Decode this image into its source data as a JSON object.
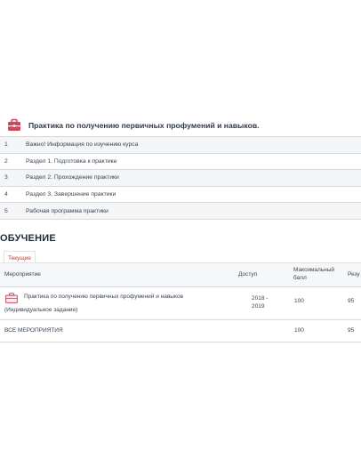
{
  "course": {
    "title": "Практика по получению первичных профумений и навыков.",
    "icon": "briefcase-icon"
  },
  "modules": [
    {
      "num": "1",
      "label": "Важно! Информация по изучению курса"
    },
    {
      "num": "2",
      "label": "Раздел 1. Подготовка к практике"
    },
    {
      "num": "3",
      "label": "Раздел 2. Прохождение практики"
    },
    {
      "num": "4",
      "label": "Раздел 3. Завершение практики"
    },
    {
      "num": "5",
      "label": "Рабочая программа практики"
    }
  ],
  "section": {
    "title": "ОБУЧЕНИЕ",
    "tab_current": "Текущие"
  },
  "table": {
    "col_event": "Мероприятие",
    "col_access": "Доступ",
    "col_max_line1": "Максимальный",
    "col_max_line2": "балл",
    "col_result": "Резу",
    "rows": [
      {
        "name": "Практика по получению первичных профумений и навыков",
        "type": "(Индивидуальное задание)",
        "access_line1": "2018 -",
        "access_line2": "2019",
        "max": "100",
        "result": "95"
      }
    ],
    "total_label": "ВСЕ МЕРОПРИЯТИЯ",
    "total_max": "100",
    "total_result": "95"
  },
  "colors": {
    "accent": "#c0392b",
    "text": "#2f3a48"
  }
}
